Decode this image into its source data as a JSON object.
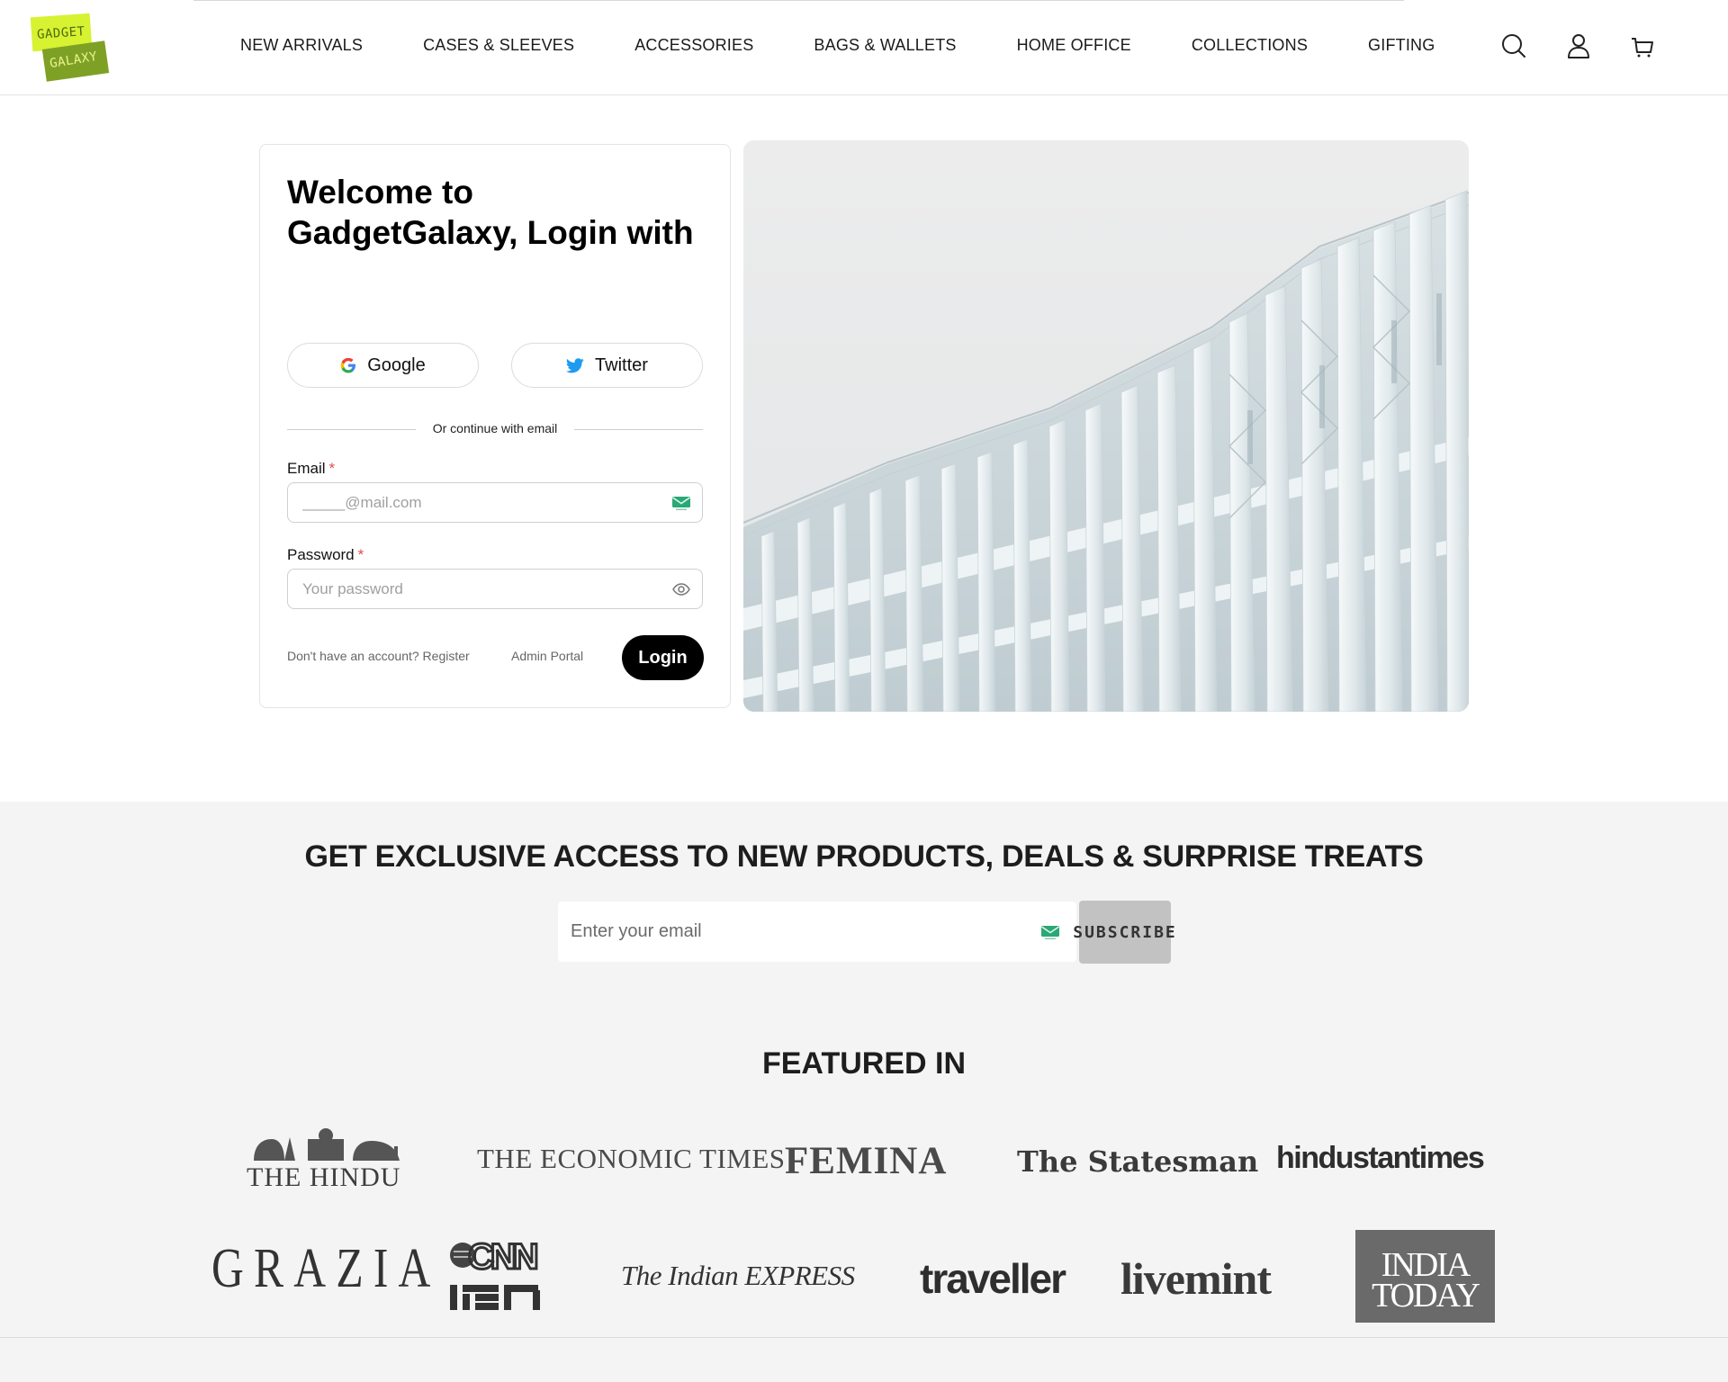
{
  "brand": {
    "line1": "GADGET",
    "line2": "GALAXY",
    "colors": {
      "top": "#d7f231",
      "bottom": "#7ea125"
    }
  },
  "nav": {
    "items": [
      "NEW ARRIVALS",
      "CASES & SLEEVES",
      "ACCESSORIES",
      "BAGS & WALLETS",
      "HOME OFFICE",
      "COLLECTIONS",
      "GIFTING"
    ]
  },
  "header_icons": [
    "search-icon",
    "user-icon",
    "cart-icon"
  ],
  "login": {
    "title": "Welcome to GadgetGalaxy, Login with",
    "google_label": "Google",
    "twitter_label": "Twitter",
    "divider_text": "Or continue with email",
    "email_label": "Email",
    "email_placeholder": "_____@mail.com",
    "password_label": "Password",
    "password_placeholder": "Your password",
    "required_mark": "*",
    "register_link": "Don't have an account? Register",
    "admin_link": "Admin Portal",
    "login_button": "Login"
  },
  "newsletter": {
    "title": "GET EXCLUSIVE ACCESS TO NEW PRODUCTS, DEALS & SURPRISE TREATS",
    "placeholder": "Enter your email",
    "button": "SUBSCRIBE"
  },
  "featured": {
    "title": "FEATURED IN",
    "logos": [
      "THE HINDU",
      "THE ECONOMIC TIMES",
      "FEMINA",
      "The Statesman",
      "hindustantimes",
      "GRAZIA",
      "CNN IBN",
      "The Indian EXPRESS",
      "traveller",
      "livemint",
      "INDIA TODAY"
    ]
  }
}
